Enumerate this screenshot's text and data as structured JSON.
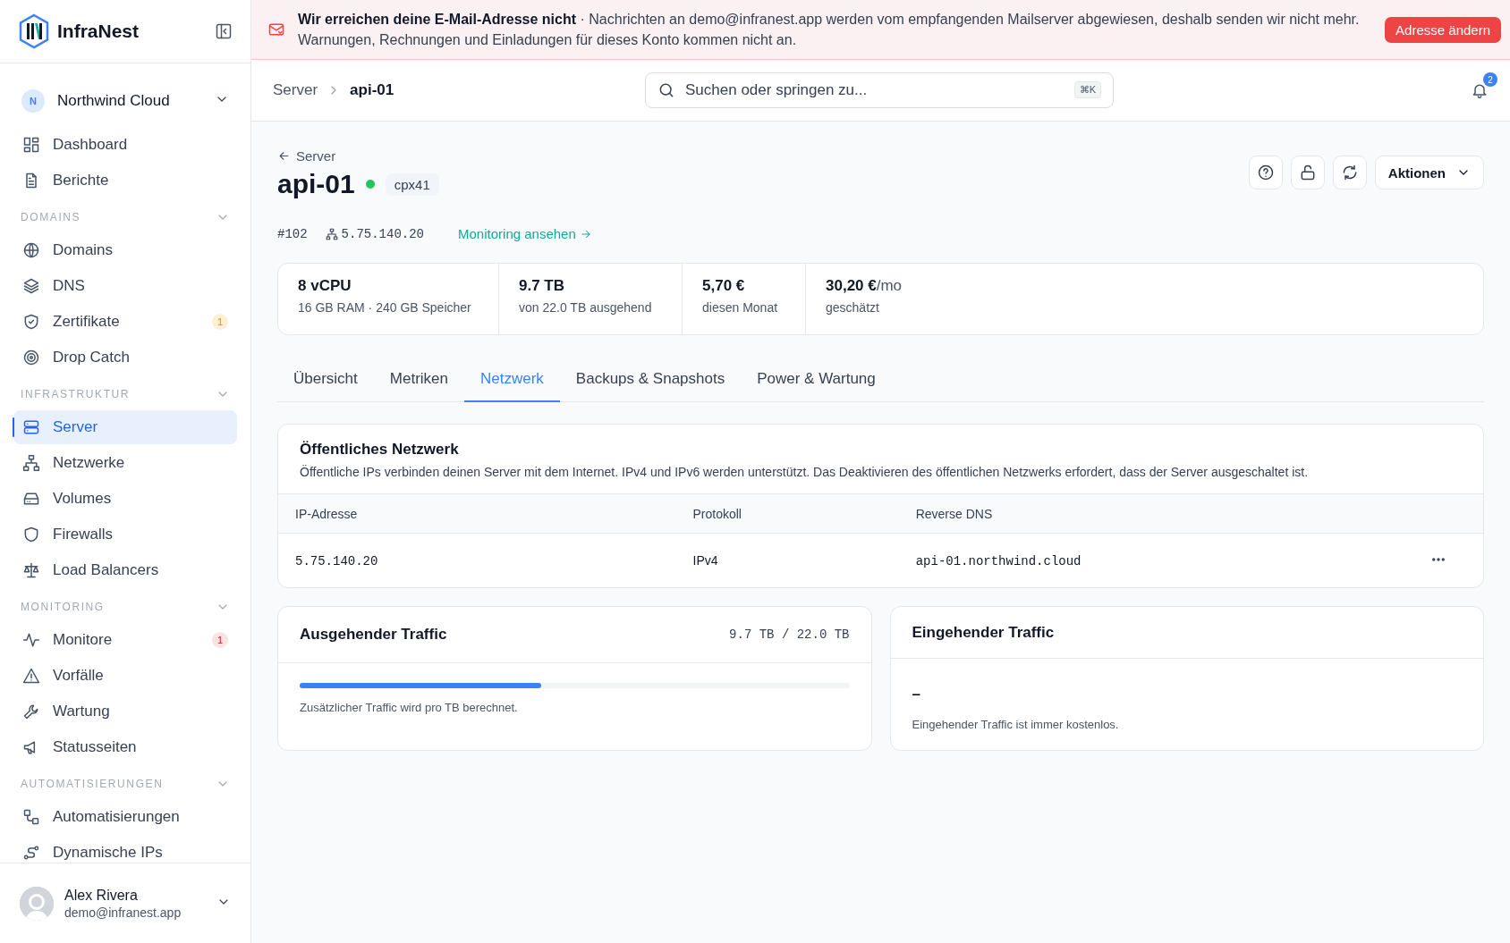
{
  "sidebar": {
    "brand": "InfraNest",
    "workspace": {
      "initial": "N",
      "name": "Northwind Cloud"
    },
    "items": [
      {
        "label": "Dashboard",
        "selected": false
      },
      {
        "label": "Berichte",
        "selected": false
      }
    ],
    "sections": [
      {
        "title": "DOMAINS",
        "expanded": true,
        "items": [
          {
            "label": "Domains",
            "selected": false
          },
          {
            "label": "DNS",
            "selected": false
          },
          {
            "label": "Zertifikate",
            "selected": false,
            "badge": {
              "text": "1",
              "color": "#fdf0d5"
            }
          },
          {
            "label": "Drop Catch",
            "selected": false
          }
        ]
      },
      {
        "title": "INFRASTRUKTUR",
        "expanded": true,
        "items": [
          {
            "label": "Server",
            "selected": true
          },
          {
            "label": "Netzwerke",
            "selected": false
          },
          {
            "label": "Volumes",
            "selected": false
          },
          {
            "label": "Firewalls",
            "selected": false
          },
          {
            "label": "Load Balancers",
            "selected": false
          }
        ]
      },
      {
        "title": "MONITORING",
        "expanded": true,
        "items": [
          {
            "label": "Monitore",
            "selected": false,
            "badge": {
              "text": "1",
              "color": "#fde2e2"
            }
          },
          {
            "label": "Vorfälle",
            "selected": false
          },
          {
            "label": "Wartung",
            "selected": false
          },
          {
            "label": "Statusseiten",
            "selected": false
          }
        ]
      },
      {
        "title": "AUTOMATISIERUNGEN",
        "expanded": true,
        "items": [
          {
            "label": "Automatisierungen",
            "selected": false
          },
          {
            "label": "Dynamische IPs",
            "selected": false
          }
        ]
      }
    ],
    "user": {
      "name": "Alex Rivera",
      "email": "demo@infranest.app"
    }
  },
  "banner": {
    "title": "Wir erreichen deine E-Mail-Adresse nicht",
    "message": "· Nachrichten an demo@infranest.app werden vom empfangenden Mailserver abgewiesen, deshalb senden wir nicht mehr. Warnungen, Rechnungen und Einladungen für dieses Konto kommen nicht an.",
    "button": "Adresse ändern"
  },
  "topbar": {
    "breadcrumb": [
      "Server",
      "api-01"
    ],
    "search": {
      "placeholder": "Suchen oder springen zu...",
      "shortcut": "⌘K"
    },
    "notifications": "2"
  },
  "server": {
    "back": "Server",
    "name": "api-01",
    "online": true,
    "type": "cpx41",
    "id": "#102",
    "ip": "5.75.140.20",
    "monitoring_link": "Monitoring ansehen",
    "actions": "Aktionen"
  },
  "stats": [
    {
      "value": "8 vCPU",
      "caption": "16 GB RAM · 240 GB Speicher"
    },
    {
      "value": "9.7 TB",
      "caption": "von 22.0 TB ausgehend"
    },
    {
      "value": "5,70 €",
      "caption": "diesen Monat"
    },
    {
      "value": "30,20 €",
      "unit": "/mo",
      "caption": "geschätzt"
    }
  ],
  "tabs": [
    {
      "label": "Übersicht",
      "selected": false
    },
    {
      "label": "Metriken",
      "selected": false
    },
    {
      "label": "Netzwerk",
      "selected": true
    },
    {
      "label": "Backups & Snapshots",
      "selected": false
    },
    {
      "label": "Power & Wartung",
      "selected": false
    }
  ],
  "network": {
    "title": "Öffentliches Netzwerk",
    "description": "Öffentliche IPs verbinden deinen Server mit dem Internet. IPv4 und IPv6 werden unterstützt. Das Deaktivieren des öffentlichen Netzwerks erfordert, dass der Server ausgeschaltet ist.",
    "columns": [
      "IP-Adresse",
      "Protokoll",
      "Reverse DNS"
    ],
    "rows": [
      {
        "ip": "5.75.140.20",
        "protocol": "IPv4",
        "reverse_dns": "api-01.northwind.cloud"
      }
    ]
  },
  "outgoing": {
    "title": "Ausgehender Traffic",
    "reading": "9.7 TB / 22.0 TB",
    "level": 0.44,
    "note": "Zusätzlicher Traffic wird pro TB berechnet."
  },
  "incoming": {
    "title": "Eingehender Traffic",
    "value": "–",
    "note": "Eingehender Traffic ist immer kostenlos."
  }
}
